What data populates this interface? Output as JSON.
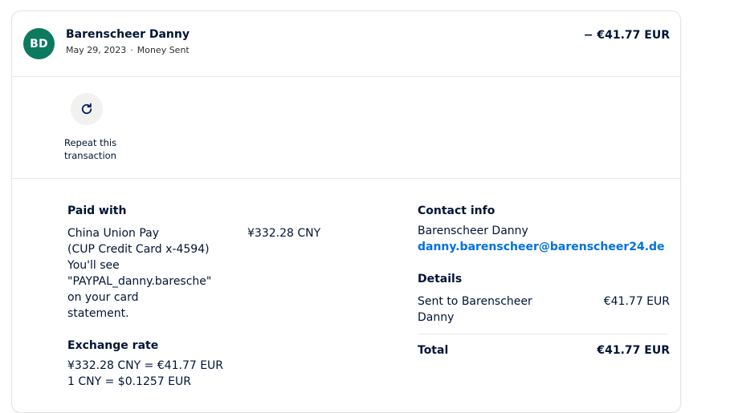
{
  "header": {
    "avatar_initials": "BD",
    "name": "Barenscheer Danny",
    "date": "May 29, 2023",
    "type": "Money Sent",
    "amount": "− €41.77 EUR"
  },
  "actions": {
    "repeat_label": "Repeat this transaction",
    "repeat_icon": "refresh-icon"
  },
  "paid_with": {
    "heading": "Paid with",
    "method_lines": [
      "China Union Pay",
      "(CUP Credit Card x-4594)",
      "You'll see",
      "\"PAYPAL_danny.baresche\"",
      "on your card",
      "statement."
    ],
    "amount": "¥332.28 CNY"
  },
  "exchange": {
    "heading": "Exchange rate",
    "line1": "¥332.28 CNY = €41.77 EUR",
    "line2": "1 CNY = $0.1257 EUR"
  },
  "contact": {
    "heading": "Contact info",
    "name": "Barenscheer Danny",
    "email": "danny.barenscheer@barenscheer24.de"
  },
  "details": {
    "heading": "Details",
    "sent_to_label": "Sent to Barenscheer Danny",
    "sent_to_amount": "€41.77 EUR",
    "total_label": "Total",
    "total_amount": "€41.77 EUR"
  },
  "colors": {
    "avatar_bg": "#0b7a5e",
    "link": "#0070e0",
    "text": "#001435"
  }
}
